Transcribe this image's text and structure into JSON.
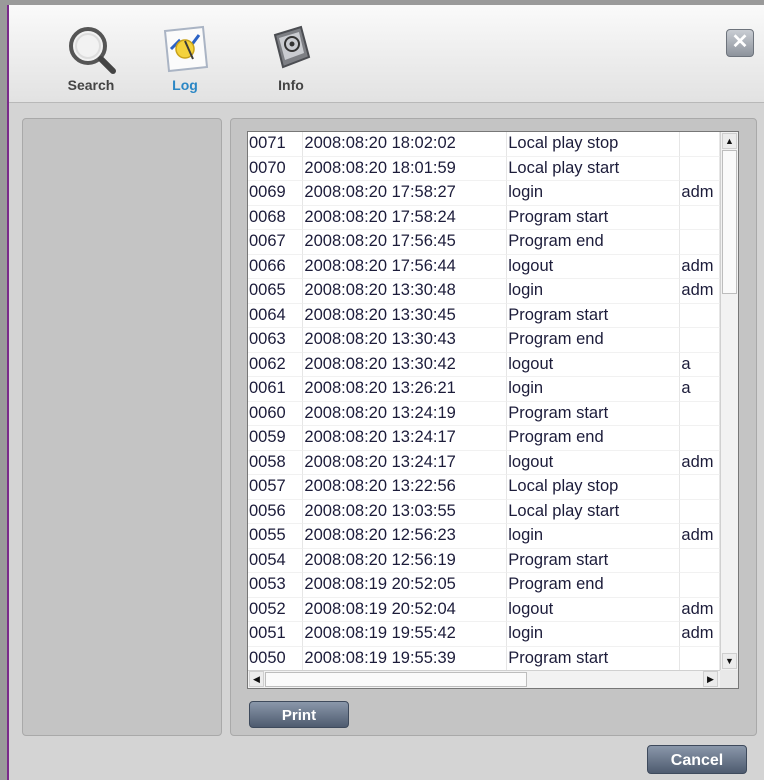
{
  "toolbar": {
    "tabs": [
      {
        "label": "Search",
        "icon": "search-icon"
      },
      {
        "label": "Log",
        "icon": "log-icon",
        "active": true
      },
      {
        "label": "Info",
        "icon": "info-icon"
      }
    ],
    "close_glyph": "✕"
  },
  "log": {
    "rows": [
      {
        "num": "0071",
        "datetime": "2008:08:20 18:02:02",
        "event": "Local play stop",
        "user": ""
      },
      {
        "num": "0070",
        "datetime": "2008:08:20 18:01:59",
        "event": "Local play start",
        "user": ""
      },
      {
        "num": "0069",
        "datetime": "2008:08:20 17:58:27",
        "event": "login",
        "user": "adm"
      },
      {
        "num": "0068",
        "datetime": "2008:08:20 17:58:24",
        "event": "Program start",
        "user": ""
      },
      {
        "num": "0067",
        "datetime": "2008:08:20 17:56:45",
        "event": "Program end",
        "user": ""
      },
      {
        "num": "0066",
        "datetime": "2008:08:20 17:56:44",
        "event": "logout",
        "user": "adm"
      },
      {
        "num": "0065",
        "datetime": "2008:08:20 13:30:48",
        "event": "login",
        "user": "adm"
      },
      {
        "num": "0064",
        "datetime": "2008:08:20 13:30:45",
        "event": "Program start",
        "user": ""
      },
      {
        "num": "0063",
        "datetime": "2008:08:20 13:30:43",
        "event": "Program end",
        "user": ""
      },
      {
        "num": "0062",
        "datetime": "2008:08:20 13:30:42",
        "event": "logout",
        "user": "a"
      },
      {
        "num": "0061",
        "datetime": "2008:08:20 13:26:21",
        "event": "login",
        "user": "a"
      },
      {
        "num": "0060",
        "datetime": "2008:08:20 13:24:19",
        "event": "Program start",
        "user": ""
      },
      {
        "num": "0059",
        "datetime": "2008:08:20 13:24:17",
        "event": "Program end",
        "user": ""
      },
      {
        "num": "0058",
        "datetime": "2008:08:20 13:24:17",
        "event": "logout",
        "user": "adm"
      },
      {
        "num": "0057",
        "datetime": "2008:08:20 13:22:56",
        "event": "Local play stop",
        "user": ""
      },
      {
        "num": "0056",
        "datetime": "2008:08:20 13:03:55",
        "event": "Local play start",
        "user": ""
      },
      {
        "num": "0055",
        "datetime": "2008:08:20 12:56:23",
        "event": "login",
        "user": "adm"
      },
      {
        "num": "0054",
        "datetime": "2008:08:20 12:56:19",
        "event": "Program start",
        "user": ""
      },
      {
        "num": "0053",
        "datetime": "2008:08:19 20:52:05",
        "event": "Program end",
        "user": ""
      },
      {
        "num": "0052",
        "datetime": "2008:08:19 20:52:04",
        "event": "logout",
        "user": "adm"
      },
      {
        "num": "0051",
        "datetime": "2008:08:19 19:55:42",
        "event": "login",
        "user": "adm"
      },
      {
        "num": "0050",
        "datetime": "2008:08:19 19:55:39",
        "event": "Program start",
        "user": ""
      }
    ]
  },
  "buttons": {
    "print_label": "Print",
    "cancel_label": "Cancel"
  },
  "scrollbar": {
    "up_glyph": "▲",
    "down_glyph": "▼",
    "left_glyph": "◀",
    "right_glyph": "▶"
  },
  "colors": {
    "active_tab": "#2b87c5",
    "button": "#5f6c80"
  }
}
